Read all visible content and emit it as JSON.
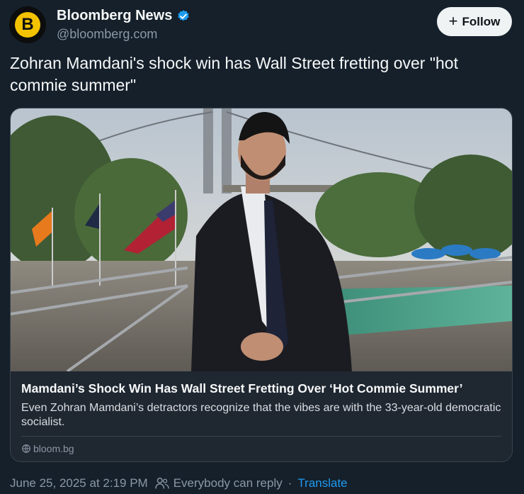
{
  "author": {
    "name": "Bloomberg News",
    "handle": "@bloomberg.com",
    "avatar_letter": "B",
    "verified": true,
    "avatar_color": "#f4c300"
  },
  "follow_button": {
    "label": "Follow",
    "icon": "plus-icon"
  },
  "tweet": {
    "text": "Zohran Mamdani's shock win has Wall Street fretting over \"hot commie summer\""
  },
  "card": {
    "title": "Mamdani’s Shock Win Has Wall Street Fretting Over ‘Hot Commie Summer’",
    "description": "Even Zohran Mamdani’s detractors recognize that the vibes are with the 33-year-old democratic socialist.",
    "domain": "bloom.bg"
  },
  "meta": {
    "timestamp": "June 25, 2025 at 2:19 PM",
    "reply_setting": "Everybody can reply",
    "separator": "·",
    "translate_label": "Translate"
  },
  "colors": {
    "background": "#15202b",
    "link": "#1d9bf0",
    "verified": "#1d9bf0"
  }
}
